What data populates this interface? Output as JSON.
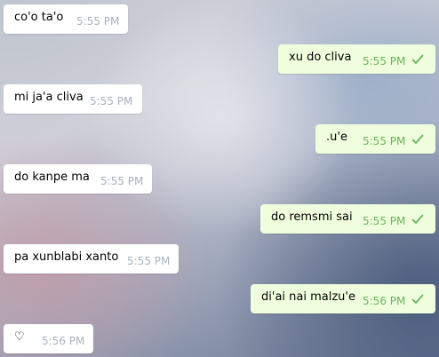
{
  "messages": [
    {
      "text": "co'o ta'o",
      "time": "5:55 PM",
      "direction": "in"
    },
    {
      "text": "xu do cliva",
      "time": "5:55 PM",
      "direction": "out",
      "status": "check-icon"
    },
    {
      "text": "mi ja'a cliva",
      "time": "5:55 PM",
      "direction": "in"
    },
    {
      "text": ".u'e",
      "time": "5:55 PM",
      "direction": "out",
      "status": "check-icon"
    },
    {
      "text": "do kanpe ma",
      "time": "5:55 PM",
      "direction": "in"
    },
    {
      "text": "do remsmi sai",
      "time": "5:55 PM",
      "direction": "out",
      "status": "check-icon"
    },
    {
      "text": "pa xunblabi xanto",
      "time": "5:55 PM",
      "direction": "in"
    },
    {
      "text": "di'ai nai malzu'e",
      "time": "5:56 PM",
      "direction": "out",
      "status": "check-icon"
    },
    {
      "text": "♡",
      "time": "5:56 PM",
      "direction": "in"
    }
  ],
  "colors": {
    "incoming_bubble": "#ffffff",
    "outgoing_bubble": "#efffde",
    "incoming_time": "#a9b2bc",
    "outgoing_time_and_check": "#6cb25a"
  }
}
